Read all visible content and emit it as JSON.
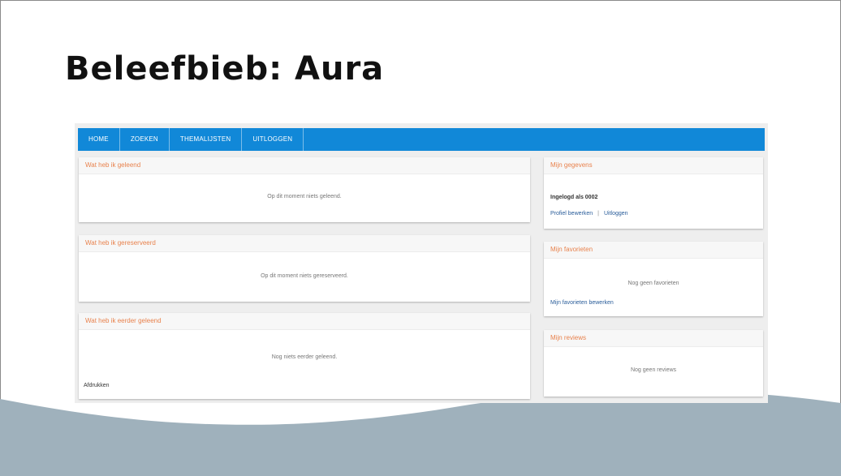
{
  "slide": {
    "title": "Beleefbieb: Aura"
  },
  "nav": {
    "items": [
      {
        "label": "HOME"
      },
      {
        "label": "ZOEKEN"
      },
      {
        "label": "THEMALIJSTEN"
      },
      {
        "label": "UITLOGGEN"
      }
    ]
  },
  "left": {
    "borrowed": {
      "title": "Wat heb ik geleend",
      "empty": "Op dit moment niets geleend."
    },
    "reserved": {
      "title": "Wat heb ik gereserveerd",
      "empty": "Op dit moment niets gereserveerd."
    },
    "earlier": {
      "title": "Wat heb ik eerder geleend",
      "empty": "Nog niets eerder geleend.",
      "footer": "Afdrukken"
    }
  },
  "right": {
    "account": {
      "title": "Mijn gegevens",
      "logged_in": "Ingelogd als 0002",
      "edit_profile": "Profiel bewerken",
      "separator": "|",
      "logout": "Uitloggen"
    },
    "favorites": {
      "title": "Mijn favorieten",
      "empty": "Nog geen favorieten",
      "manage": "Mijn favorieten bewerken"
    },
    "reviews": {
      "title": "Mijn reviews",
      "empty": "Nog geen reviews"
    }
  },
  "colors": {
    "nav_blue": "#1188d8",
    "heading_orange": "#e8824d",
    "wave_fill": "#9fb1bc"
  }
}
